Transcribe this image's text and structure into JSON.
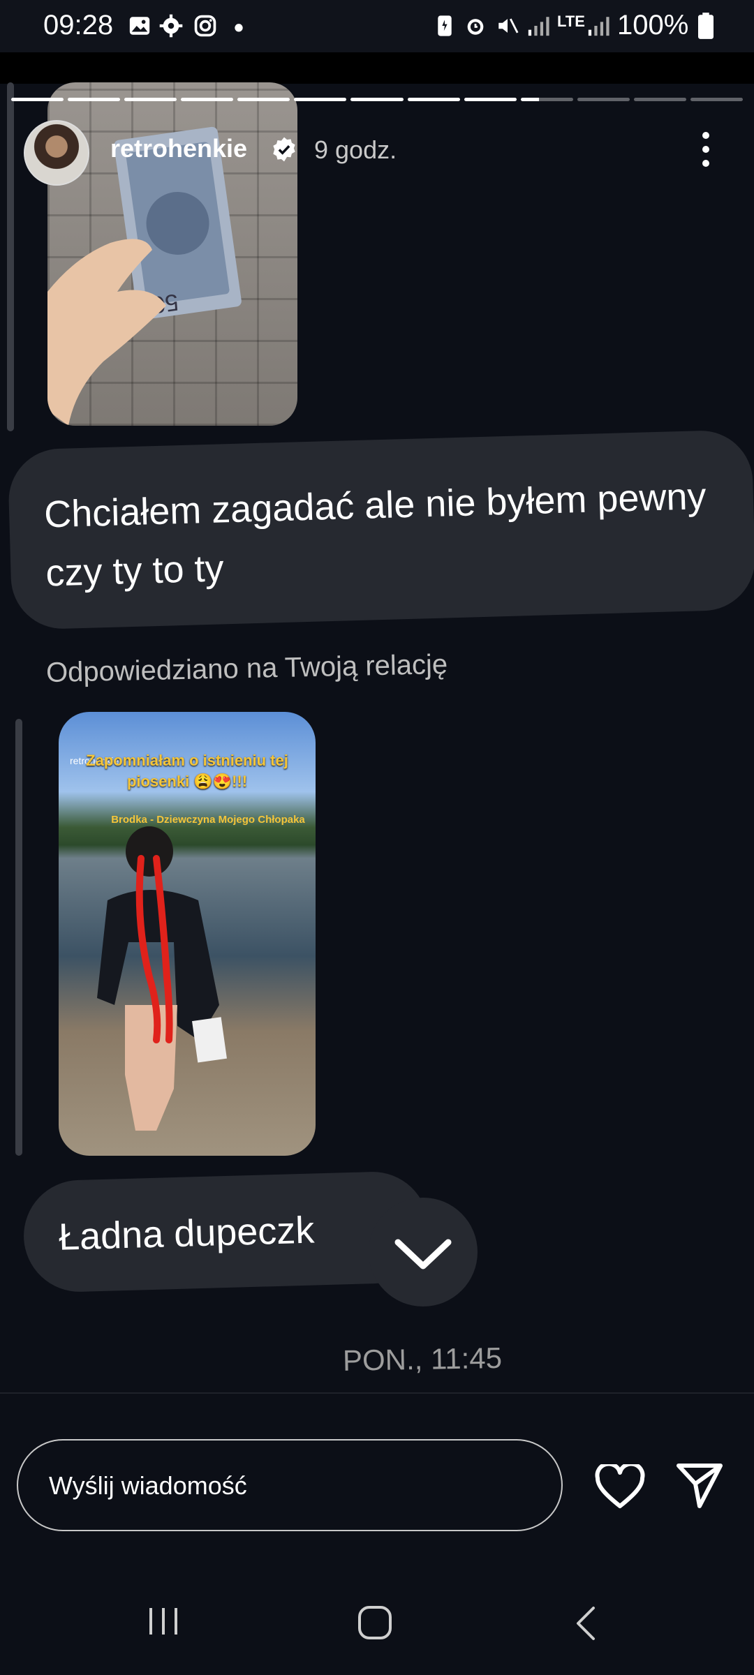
{
  "status_bar": {
    "time": "09:28",
    "battery": "100%",
    "network": "LTE"
  },
  "story": {
    "progress_segments": 13,
    "progress_done": 9,
    "username": "retrohenkie",
    "verified": true,
    "time_ago": "9 godz."
  },
  "messages": {
    "first": "Chciałem zagadać ale nie byłem pewny czy ty to ty",
    "replied_label": "Odpowiedziano na Twoją relację",
    "story_user": "retrohenkie",
    "story_caption": "Zapomniałam o istnieniu tej piosenki 😩😍!!!",
    "story_song": "Brodka - Dziewczyna Mojego Chłopaka",
    "second": "Ładna dupeczk",
    "timestamp": "PON., 11:45"
  },
  "composer": {
    "placeholder": "Wyślij wiadomość"
  },
  "icons": {
    "status": [
      "gallery-icon",
      "settings-icon",
      "instagram-icon",
      "dot-icon"
    ],
    "heart": "heart-icon",
    "send": "send-icon",
    "more": "more-vertical-icon",
    "scroll": "chevron-down-icon"
  },
  "colors": {
    "background": "#0c0f17",
    "bubble": "#262930",
    "secondary_text": "#bfbfbf",
    "story_caption": "#f4c53a"
  }
}
